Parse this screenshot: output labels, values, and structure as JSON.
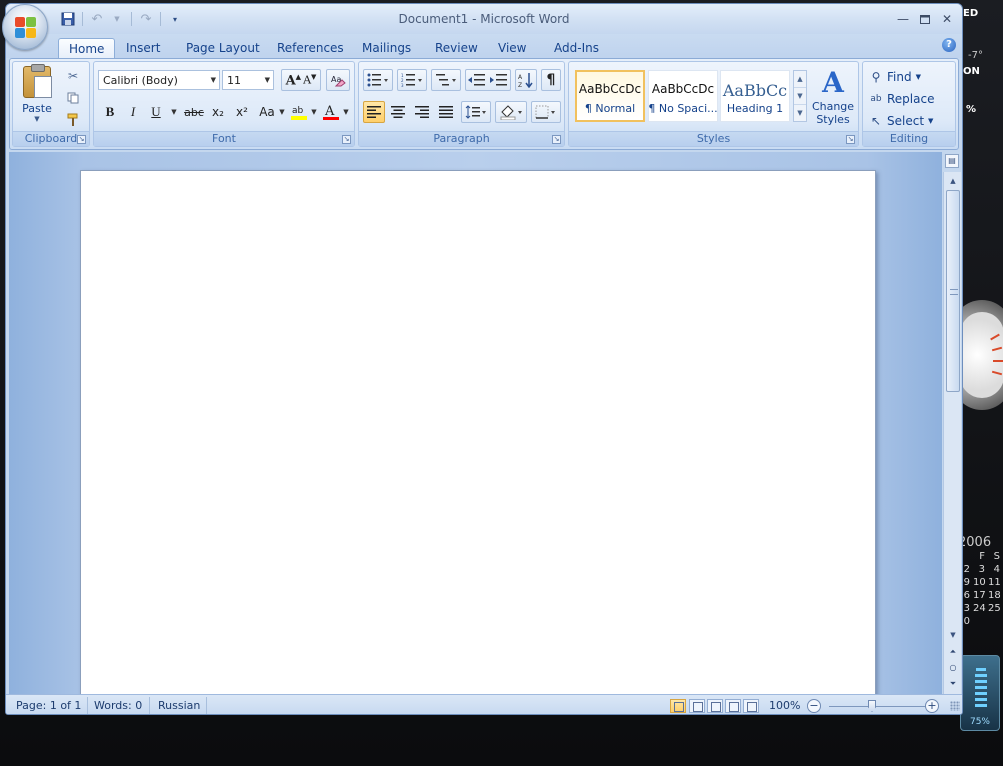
{
  "window": {
    "title": "Document1 - Microsoft Word",
    "controls": [
      "minimize",
      "maximize",
      "close"
    ]
  },
  "quick_access": [
    "save-icon",
    "undo-icon",
    "redo-icon",
    "customize-icon"
  ],
  "tabs": [
    {
      "label": "Home",
      "active": true
    },
    {
      "label": "Insert"
    },
    {
      "label": "Page Layout"
    },
    {
      "label": "References"
    },
    {
      "label": "Mailings"
    },
    {
      "label": "Review"
    },
    {
      "label": "View"
    },
    {
      "label": "Add-Ins"
    }
  ],
  "ribbon": {
    "clipboard": {
      "label": "Clipboard",
      "paste_label": "Paste"
    },
    "font": {
      "label": "Font",
      "font_name": "Calibri (Body)",
      "font_size": "11",
      "bold": "B",
      "italic": "I",
      "underline": "U",
      "strikethrough": "abc",
      "subscript": "x₂",
      "superscript": "x²",
      "change_case": "Aa",
      "highlight_color": "#ffff00",
      "font_color": "#ff0000"
    },
    "paragraph": {
      "label": "Paragraph",
      "alignment": "left"
    },
    "styles": {
      "label": "Styles",
      "items": [
        {
          "sample": "AaBbCcDc",
          "name": "¶ Normal",
          "active": true
        },
        {
          "sample": "AaBbCcDc",
          "name": "¶ No Spaci..."
        },
        {
          "sample": "AaBbCc",
          "name": "Heading 1"
        }
      ],
      "change_styles_line1": "Change",
      "change_styles_line2": "Styles"
    },
    "editing": {
      "label": "Editing",
      "find": "Find",
      "replace": "Replace",
      "select": "Select"
    }
  },
  "statusbar": {
    "page": "Page: 1 of 1",
    "words": "Words: 0",
    "language": "Russian",
    "zoom": "100%",
    "zoom_minus": "−",
    "zoom_plus": "+"
  },
  "desktop_widgets": {
    "weather_text_1": "ED",
    "weather_temp": "-7°",
    "weather_text_2": "ON",
    "percent_text": "%",
    "calendar_year": "2006",
    "calendar_header": [
      "F",
      "S"
    ],
    "calendar_rows": [
      [
        "2",
        "3",
        "4"
      ],
      [
        "9",
        "10",
        "11"
      ],
      [
        "6",
        "17",
        "18"
      ],
      [
        "3",
        "24",
        "25"
      ],
      [
        "0",
        "",
        ""
      ]
    ],
    "meter_label": "75%"
  },
  "colors": {
    "accent": "#15428b",
    "ribbon_bg": "#dbe7f6",
    "doc_bg": "#a9c3e6",
    "highlight": "#ffcf6a"
  }
}
